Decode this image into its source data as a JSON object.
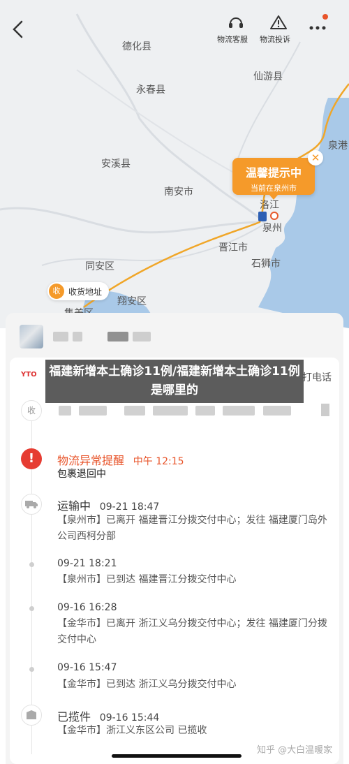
{
  "topbar": {
    "service_label": "物流客服",
    "complaint_label": "物流投诉"
  },
  "map": {
    "places": [
      "德化县",
      "仙游县",
      "永春县",
      "泉港",
      "安溪县",
      "南安市",
      "洛江",
      "泉州",
      "晋江市",
      "石狮市",
      "同安区",
      "翔安区",
      "集美区"
    ],
    "callout_title": "温馨提示中",
    "callout_sub": "当前在泉州市",
    "receive_badge": "收",
    "receive_label": "收货地址"
  },
  "header": {
    "watermark_title": "福建新增本土确诊11例/福建新增本土确诊11例是哪里的",
    "call_label": "打电话",
    "collect_badge": "收"
  },
  "alert": {
    "status": "物流异常提醒",
    "time": "中午 12:15",
    "detail": "包裹退回中"
  },
  "events": [
    {
      "status": "运输中",
      "time": "09-21 18:47",
      "detail": "【泉州市】已离开 福建晋江分拨交付中心；发往 福建厦门岛外公司西柯分部"
    },
    {
      "time": "09-21 18:21",
      "detail": "【泉州市】已到达 福建晋江分拨交付中心"
    },
    {
      "time": "09-16 16:28",
      "detail": "【金华市】已离开 浙江义乌分拨交付中心；发往 福建厦门分拨交付中心"
    },
    {
      "time": "09-16 15:47",
      "detail": "【金华市】已到达 浙江义乌分拨交付中心"
    },
    {
      "status": "已揽件",
      "time": "09-16 15:44",
      "detail": "【金华市】浙江义东区公司 已揽收"
    }
  ],
  "footer": {
    "watermark": "知乎 @大白温暖家"
  },
  "colors": {
    "accent_orange": "#f59a2a",
    "alert_red": "#e63c32",
    "sea_blue": "#a9c9e8"
  }
}
